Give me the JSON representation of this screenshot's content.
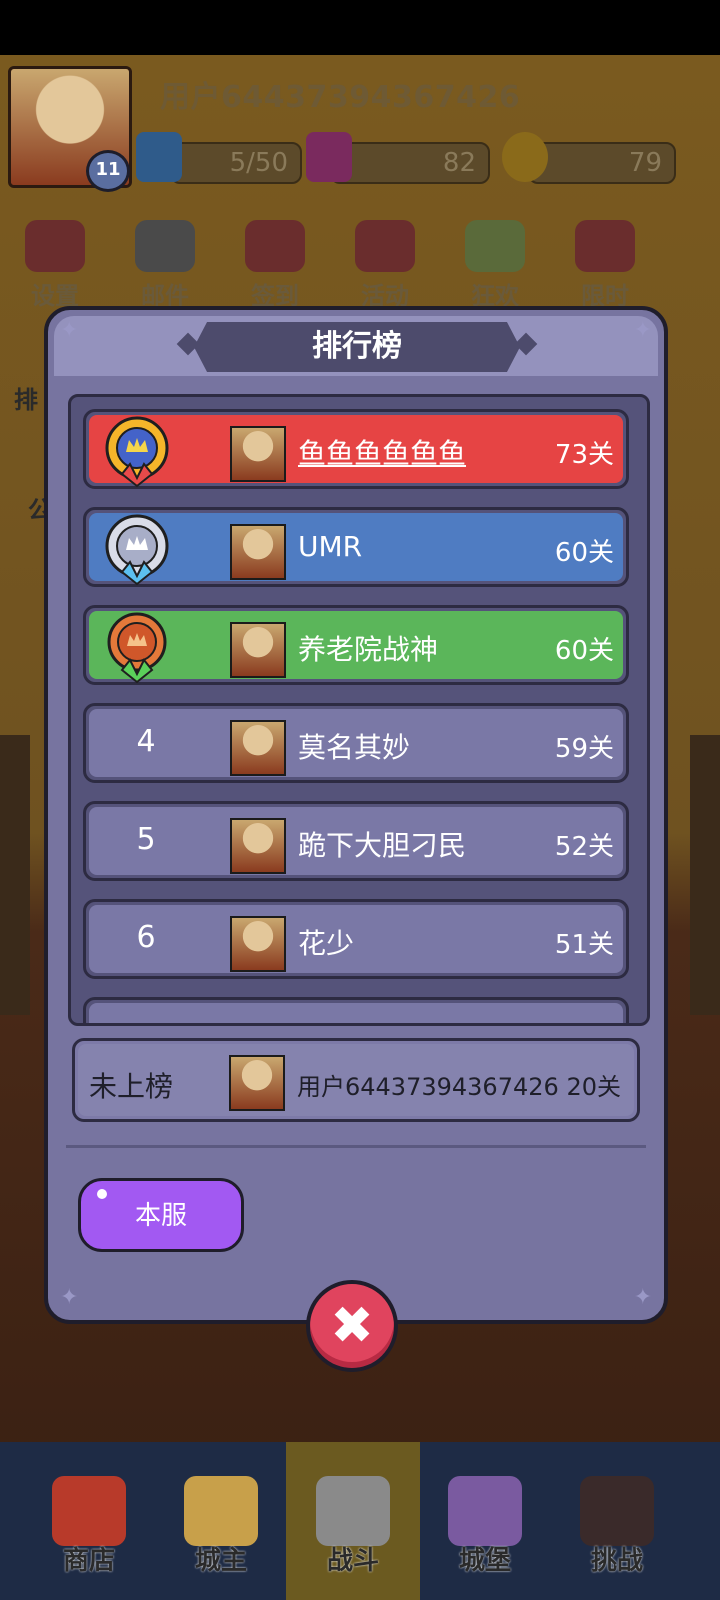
{
  "player": {
    "name": "用户64437394367426",
    "level": "11",
    "energy": "5/50",
    "gems": "82",
    "gold": "79"
  },
  "menu": [
    {
      "label": "设置",
      "icon": "gear-icon"
    },
    {
      "label": "邮件",
      "icon": "mail-icon"
    },
    {
      "label": "签到",
      "icon": "calendar-icon"
    },
    {
      "label": "活动",
      "icon": "gift-icon"
    },
    {
      "label": "狂欢",
      "icon": "balloon-icon"
    },
    {
      "label": "限时",
      "icon": "clock-gift-icon"
    }
  ],
  "side_labels": {
    "left_1": "排",
    "left_2": "公"
  },
  "leaderboard": {
    "title": "排行榜",
    "rows": [
      {
        "rank": "1",
        "name": "鱼鱼鱼鱼鱼鱼",
        "score": "73关",
        "color": "#e64444",
        "medal": "gold-medal-icon"
      },
      {
        "rank": "2",
        "name": "UMR",
        "score": "60关",
        "color": "#4f7cc2",
        "medal": "silver-medal-icon"
      },
      {
        "rank": "3",
        "name": "养老院战神",
        "score": "60关",
        "color": "#5bb65a",
        "medal": "bronze-medal-icon"
      },
      {
        "rank": "4",
        "name": "莫名其妙",
        "score": "59关",
        "color": "#7a78a6"
      },
      {
        "rank": "5",
        "name": "跪下大胆刁民",
        "score": "52关",
        "color": "#7a78a6"
      },
      {
        "rank": "6",
        "name": "花少",
        "score": "51关",
        "color": "#7a78a6"
      }
    ],
    "self": {
      "rank_text": "未上榜",
      "name": "用户64437394367426",
      "score": "20关"
    },
    "server_button": "本服"
  },
  "bottom_nav": [
    {
      "label": "商店",
      "icon": "shop-icon",
      "active": false
    },
    {
      "label": "城主",
      "icon": "crown-icon",
      "active": false
    },
    {
      "label": "战斗",
      "icon": "swords-icon",
      "active": true
    },
    {
      "label": "城堡",
      "icon": "castle-icon",
      "active": false
    },
    {
      "label": "挑战",
      "icon": "demon-icon",
      "active": false
    }
  ]
}
